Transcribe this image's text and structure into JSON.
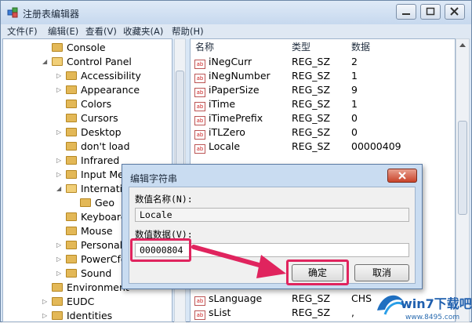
{
  "window": {
    "title": "注册表编辑器"
  },
  "menu": [
    "文件(F)",
    "编辑(E)",
    "查看(V)",
    "收藏夹(A)",
    "帮助(H)"
  ],
  "tree": [
    {
      "label": "Console",
      "indent": 0,
      "expander": ""
    },
    {
      "label": "Control Panel",
      "indent": 0,
      "expander": "open"
    },
    {
      "label": "Accessibility",
      "indent": 1,
      "expander": "closed"
    },
    {
      "label": "Appearance",
      "indent": 1,
      "expander": "closed"
    },
    {
      "label": "Colors",
      "indent": 1,
      "expander": ""
    },
    {
      "label": "Cursors",
      "indent": 1,
      "expander": ""
    },
    {
      "label": "Desktop",
      "indent": 1,
      "expander": "closed"
    },
    {
      "label": "don't load",
      "indent": 1,
      "expander": ""
    },
    {
      "label": "Infrared",
      "indent": 1,
      "expander": "closed"
    },
    {
      "label": "Input Met",
      "indent": 1,
      "expander": "closed"
    },
    {
      "label": "Internatio",
      "indent": 1,
      "expander": "open"
    },
    {
      "label": "Geo",
      "indent": 2,
      "expander": ""
    },
    {
      "label": "Keyboard",
      "indent": 1,
      "expander": ""
    },
    {
      "label": "Mouse",
      "indent": 1,
      "expander": ""
    },
    {
      "label": "Personaliz",
      "indent": 1,
      "expander": "closed"
    },
    {
      "label": "PowerCfg",
      "indent": 1,
      "expander": "closed"
    },
    {
      "label": "Sound",
      "indent": 1,
      "expander": "closed"
    },
    {
      "label": "Environment",
      "indent": 0,
      "expander": ""
    },
    {
      "label": "EUDC",
      "indent": 0,
      "expander": "closed"
    },
    {
      "label": "Identities",
      "indent": 0,
      "expander": "closed"
    }
  ],
  "list": {
    "headers": {
      "name": "名称",
      "type": "类型",
      "data": "数据"
    },
    "rows": [
      {
        "name": "iNegCurr",
        "type": "REG_SZ",
        "data": "2"
      },
      {
        "name": "iNegNumber",
        "type": "REG_SZ",
        "data": "1"
      },
      {
        "name": "iPaperSize",
        "type": "REG_SZ",
        "data": "9"
      },
      {
        "name": "iTime",
        "type": "REG_SZ",
        "data": "1"
      },
      {
        "name": "iTimePrefix",
        "type": "REG_SZ",
        "data": "0"
      },
      {
        "name": "iTLZero",
        "type": "REG_SZ",
        "data": "0"
      },
      {
        "name": "Locale",
        "type": "REG_SZ",
        "data": "00000409"
      }
    ],
    "bottom_rows": [
      {
        "name": "sLanguage",
        "type": "REG_SZ",
        "data": "CHS"
      },
      {
        "name": "sList",
        "type": "REG_SZ",
        "data": ","
      }
    ]
  },
  "dialog": {
    "title": "编辑字符串",
    "name_label": "数值名称(N):",
    "name_value": "Locale",
    "data_label": "数值数据(V):",
    "data_value": "00000804",
    "ok": "确定",
    "cancel": "取消"
  },
  "watermark": {
    "brand": "win7下载吧",
    "url": "www.8495.com"
  },
  "colors": {
    "highlight": "#e0245e",
    "folder": "#e3b857"
  }
}
